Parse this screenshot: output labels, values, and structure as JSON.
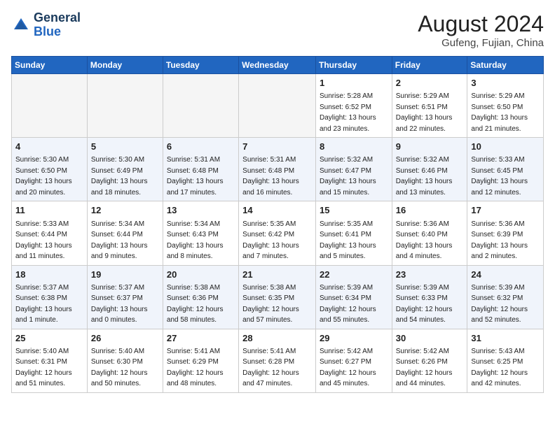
{
  "header": {
    "logo_general": "General",
    "logo_blue": "Blue",
    "month_year": "August 2024",
    "location": "Gufeng, Fujian, China"
  },
  "days_of_week": [
    "Sunday",
    "Monday",
    "Tuesday",
    "Wednesday",
    "Thursday",
    "Friday",
    "Saturday"
  ],
  "weeks": [
    [
      {
        "day": "",
        "info": ""
      },
      {
        "day": "",
        "info": ""
      },
      {
        "day": "",
        "info": ""
      },
      {
        "day": "",
        "info": ""
      },
      {
        "day": "1",
        "info": "Sunrise: 5:28 AM\nSunset: 6:52 PM\nDaylight: 13 hours\nand 23 minutes."
      },
      {
        "day": "2",
        "info": "Sunrise: 5:29 AM\nSunset: 6:51 PM\nDaylight: 13 hours\nand 22 minutes."
      },
      {
        "day": "3",
        "info": "Sunrise: 5:29 AM\nSunset: 6:50 PM\nDaylight: 13 hours\nand 21 minutes."
      }
    ],
    [
      {
        "day": "4",
        "info": "Sunrise: 5:30 AM\nSunset: 6:50 PM\nDaylight: 13 hours\nand 20 minutes."
      },
      {
        "day": "5",
        "info": "Sunrise: 5:30 AM\nSunset: 6:49 PM\nDaylight: 13 hours\nand 18 minutes."
      },
      {
        "day": "6",
        "info": "Sunrise: 5:31 AM\nSunset: 6:48 PM\nDaylight: 13 hours\nand 17 minutes."
      },
      {
        "day": "7",
        "info": "Sunrise: 5:31 AM\nSunset: 6:48 PM\nDaylight: 13 hours\nand 16 minutes."
      },
      {
        "day": "8",
        "info": "Sunrise: 5:32 AM\nSunset: 6:47 PM\nDaylight: 13 hours\nand 15 minutes."
      },
      {
        "day": "9",
        "info": "Sunrise: 5:32 AM\nSunset: 6:46 PM\nDaylight: 13 hours\nand 13 minutes."
      },
      {
        "day": "10",
        "info": "Sunrise: 5:33 AM\nSunset: 6:45 PM\nDaylight: 13 hours\nand 12 minutes."
      }
    ],
    [
      {
        "day": "11",
        "info": "Sunrise: 5:33 AM\nSunset: 6:44 PM\nDaylight: 13 hours\nand 11 minutes."
      },
      {
        "day": "12",
        "info": "Sunrise: 5:34 AM\nSunset: 6:44 PM\nDaylight: 13 hours\nand 9 minutes."
      },
      {
        "day": "13",
        "info": "Sunrise: 5:34 AM\nSunset: 6:43 PM\nDaylight: 13 hours\nand 8 minutes."
      },
      {
        "day": "14",
        "info": "Sunrise: 5:35 AM\nSunset: 6:42 PM\nDaylight: 13 hours\nand 7 minutes."
      },
      {
        "day": "15",
        "info": "Sunrise: 5:35 AM\nSunset: 6:41 PM\nDaylight: 13 hours\nand 5 minutes."
      },
      {
        "day": "16",
        "info": "Sunrise: 5:36 AM\nSunset: 6:40 PM\nDaylight: 13 hours\nand 4 minutes."
      },
      {
        "day": "17",
        "info": "Sunrise: 5:36 AM\nSunset: 6:39 PM\nDaylight: 13 hours\nand 2 minutes."
      }
    ],
    [
      {
        "day": "18",
        "info": "Sunrise: 5:37 AM\nSunset: 6:38 PM\nDaylight: 13 hours\nand 1 minute."
      },
      {
        "day": "19",
        "info": "Sunrise: 5:37 AM\nSunset: 6:37 PM\nDaylight: 13 hours\nand 0 minutes."
      },
      {
        "day": "20",
        "info": "Sunrise: 5:38 AM\nSunset: 6:36 PM\nDaylight: 12 hours\nand 58 minutes."
      },
      {
        "day": "21",
        "info": "Sunrise: 5:38 AM\nSunset: 6:35 PM\nDaylight: 12 hours\nand 57 minutes."
      },
      {
        "day": "22",
        "info": "Sunrise: 5:39 AM\nSunset: 6:34 PM\nDaylight: 12 hours\nand 55 minutes."
      },
      {
        "day": "23",
        "info": "Sunrise: 5:39 AM\nSunset: 6:33 PM\nDaylight: 12 hours\nand 54 minutes."
      },
      {
        "day": "24",
        "info": "Sunrise: 5:39 AM\nSunset: 6:32 PM\nDaylight: 12 hours\nand 52 minutes."
      }
    ],
    [
      {
        "day": "25",
        "info": "Sunrise: 5:40 AM\nSunset: 6:31 PM\nDaylight: 12 hours\nand 51 minutes."
      },
      {
        "day": "26",
        "info": "Sunrise: 5:40 AM\nSunset: 6:30 PM\nDaylight: 12 hours\nand 50 minutes."
      },
      {
        "day": "27",
        "info": "Sunrise: 5:41 AM\nSunset: 6:29 PM\nDaylight: 12 hours\nand 48 minutes."
      },
      {
        "day": "28",
        "info": "Sunrise: 5:41 AM\nSunset: 6:28 PM\nDaylight: 12 hours\nand 47 minutes."
      },
      {
        "day": "29",
        "info": "Sunrise: 5:42 AM\nSunset: 6:27 PM\nDaylight: 12 hours\nand 45 minutes."
      },
      {
        "day": "30",
        "info": "Sunrise: 5:42 AM\nSunset: 6:26 PM\nDaylight: 12 hours\nand 44 minutes."
      },
      {
        "day": "31",
        "info": "Sunrise: 5:43 AM\nSunset: 6:25 PM\nDaylight: 12 hours\nand 42 minutes."
      }
    ]
  ]
}
